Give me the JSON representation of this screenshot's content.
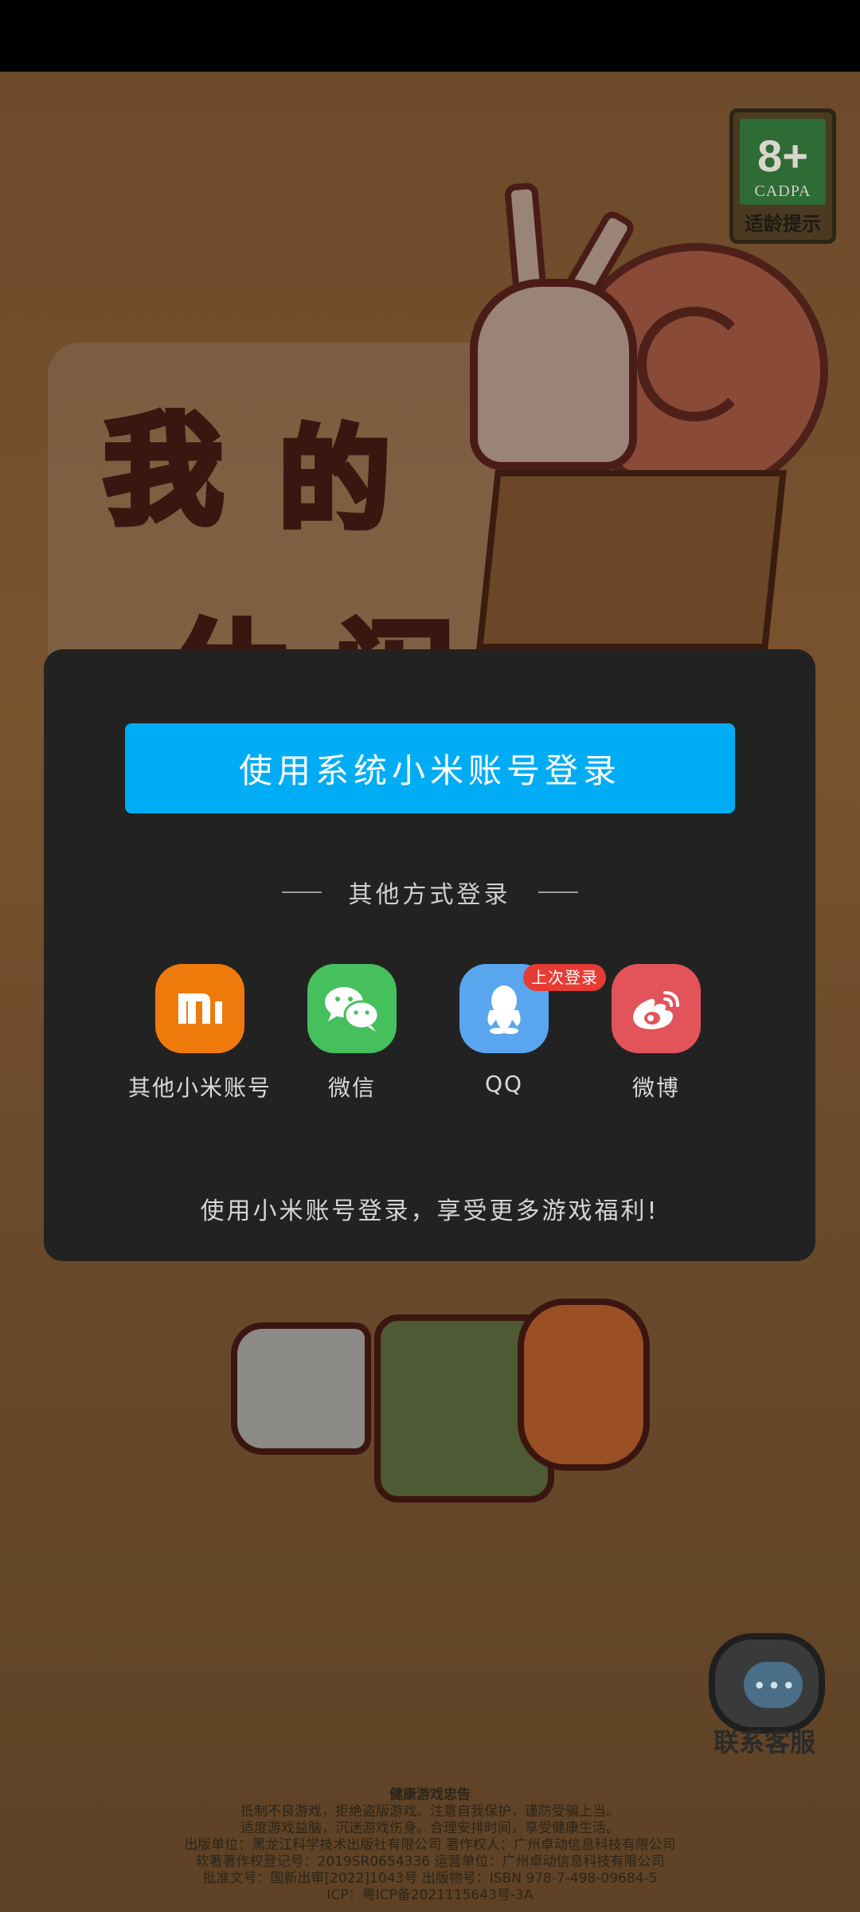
{
  "age_rating": {
    "number": "8+",
    "org": "CADPA",
    "label": "适龄提示"
  },
  "login": {
    "primary_button": "使用系统小米账号登录",
    "other_methods_label": "其他方式登录",
    "methods": [
      {
        "label": "其他小米账号",
        "icon": "xiaomi-logo-icon"
      },
      {
        "label": "微信",
        "icon": "wechat-icon"
      },
      {
        "label": "QQ",
        "icon": "qq-penguin-icon",
        "badge": "上次登录"
      },
      {
        "label": "微博",
        "icon": "weibo-icon"
      }
    ],
    "note": "使用小米账号登录，享受更多游戏福利!"
  },
  "customer_service": {
    "label": "联系客服",
    "icon": "customer-service-icon"
  },
  "legal": {
    "title": "健康游戏忠告",
    "lines": [
      "抵制不良游戏，拒绝盗版游戏。注意自我保护，谨防受骗上当。",
      "适度游戏益脑，沉迷游戏伤身。合理安排时间，享受健康生活。",
      "出版单位：黑龙江科学技术出版社有限公司  著作权人：广州卓动信息科技有限公司",
      "软著著作权登记号：2019SR0654336  运营单位：广州卓动信息科技有限公司",
      "批准文号：国新出审[2022]1043号  出版物号：ISBN 978-7-498-09684-5",
      "ICP：粤ICP备2021115643号-3A"
    ]
  },
  "colors": {
    "primary": "#00adf5",
    "panel": "#222222",
    "xiaomi": "#ef7a0c",
    "wechat": "#45c05c",
    "qq": "#59a6ef",
    "weibo": "#e2545a",
    "badge": "#e63c35"
  }
}
